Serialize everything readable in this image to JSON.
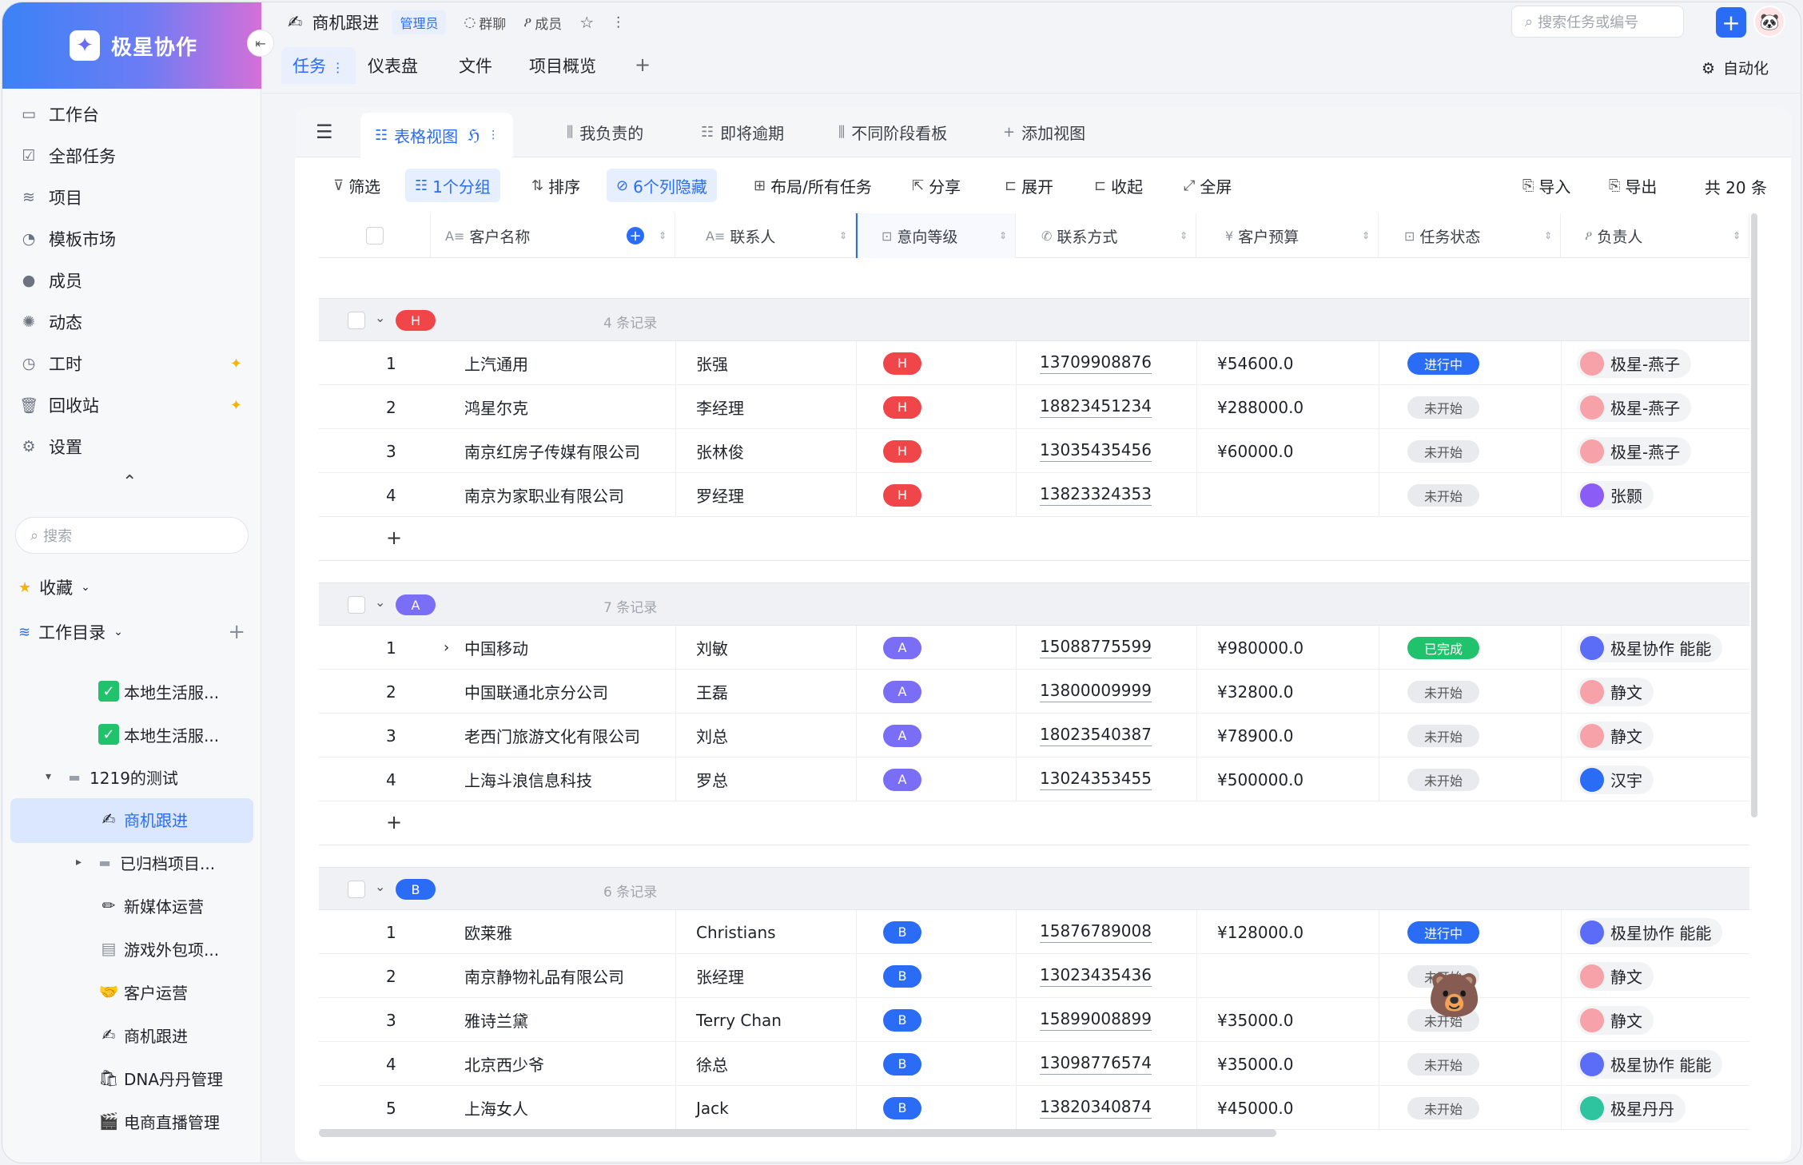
{
  "brand": {
    "name": "极星协作",
    "logo_icon": "sparkle-icon"
  },
  "sidebar": {
    "nav": [
      {
        "label": "工作台",
        "icon": "monitor-icon"
      },
      {
        "label": "全部任务",
        "icon": "task-icon"
      },
      {
        "label": "项目",
        "icon": "layers-icon"
      },
      {
        "label": "模板市场",
        "icon": "template-icon"
      },
      {
        "label": "成员",
        "icon": "user-icon"
      },
      {
        "label": "动态",
        "icon": "activity-icon"
      },
      {
        "label": "工时",
        "icon": "clock-icon",
        "starred": true
      },
      {
        "label": "回收站",
        "icon": "trash-icon",
        "starred": true
      },
      {
        "label": "设置",
        "icon": "gear-icon"
      }
    ],
    "search_placeholder": "搜索",
    "favorites_label": "收藏",
    "workdir_label": "工作目录",
    "tree": [
      {
        "label": "本地生活服...",
        "icon": "✅"
      },
      {
        "label": "本地生活服...",
        "icon": "✅"
      },
      {
        "label": "1219的测试",
        "icon": "folder"
      },
      {
        "label": "商机跟进",
        "icon": "✍"
      },
      {
        "label": "已归档项目...",
        "icon": "folder"
      },
      {
        "label": "新媒体运营",
        "icon": "✏"
      },
      {
        "label": "游戏外包项...",
        "icon": "doc"
      },
      {
        "label": "客户运营",
        "icon": "🤝"
      },
      {
        "label": "商机跟进",
        "icon": "✍"
      },
      {
        "label": "DNA丹丹管理",
        "icon": "🛍"
      },
      {
        "label": "电商直播管理",
        "icon": "🎬"
      }
    ]
  },
  "header": {
    "title": "商机跟进",
    "role_badge": "管理员",
    "group_chat": "群聊",
    "members": "成员",
    "search_placeholder": "搜索任务或编号",
    "plus": "+"
  },
  "tabs": {
    "items": [
      "任务",
      "仪表盘",
      "文件",
      "项目概览"
    ],
    "add": "+",
    "automation": "自动化"
  },
  "views": {
    "items": [
      "表格视图",
      "我负责的",
      "即将逾期",
      "不同阶段看板"
    ],
    "add": "添加视图"
  },
  "toolbar": {
    "filter": "筛选",
    "group": "1个分组",
    "sort": "排序",
    "hidden": "6个列隐藏",
    "layout": "布局/所有任务",
    "share": "分享",
    "expand": "展开",
    "collapse": "收起",
    "fullscreen": "全屏",
    "import": "导入",
    "export": "导出",
    "total": "共 20 条"
  },
  "columns": [
    "客户名称",
    "联系人",
    "意向等级",
    "联系方式",
    "客户预算",
    "任务状态",
    "负责人"
  ],
  "colors": {
    "H": "#f0464a",
    "A": "#7b6ef6",
    "B": "#2b6cf6",
    "accent": "#2b6cf6"
  },
  "groups": [
    {
      "key": "H",
      "count": "4 条记录",
      "rows": [
        {
          "n": "1",
          "name": "上汽通用",
          "contact": "张强",
          "phone": "13709908876",
          "budget": "¥54600.0",
          "status": "进行中",
          "owner": "极星-燕子"
        },
        {
          "n": "2",
          "name": "鸿星尔克",
          "contact": "李经理",
          "phone": "18823451234",
          "budget": "¥288000.0",
          "status": "未开始",
          "owner": "极星-燕子"
        },
        {
          "n": "3",
          "name": "南京红房子传媒有限公司",
          "contact": "张林俊",
          "phone": "13035435456",
          "budget": "¥60000.0",
          "status": "未开始",
          "owner": "极星-燕子"
        },
        {
          "n": "4",
          "name": "南京为家职业有限公司",
          "contact": "罗经理",
          "phone": "13823324353",
          "budget": "",
          "status": "未开始",
          "owner": "张颢"
        }
      ]
    },
    {
      "key": "A",
      "count": "7 条记录",
      "rows": [
        {
          "n": "1",
          "name": "中国移动",
          "contact": "刘敏",
          "phone": "15088775599",
          "budget": "¥980000.0",
          "status": "已完成",
          "owner": "极星协作 能能",
          "expand": true
        },
        {
          "n": "2",
          "name": "中国联通北京分公司",
          "contact": "王磊",
          "phone": "13800009999",
          "budget": "¥32800.0",
          "status": "未开始",
          "owner": "静文"
        },
        {
          "n": "3",
          "name": "老西门旅游文化有限公司",
          "contact": "刘总",
          "phone": "18023540387",
          "budget": "¥78900.0",
          "status": "未开始",
          "owner": "静文"
        },
        {
          "n": "4",
          "name": "上海斗浪信息科技",
          "contact": "罗总",
          "phone": "13024353455",
          "budget": "¥500000.0",
          "status": "未开始",
          "owner": "汉宇"
        }
      ]
    },
    {
      "key": "B",
      "count": "6 条记录",
      "rows": [
        {
          "n": "1",
          "name": "欧莱雅",
          "contact": "Christians",
          "phone": "15876789008",
          "budget": "¥128000.0",
          "status": "进行中",
          "owner": "极星协作 能能"
        },
        {
          "n": "2",
          "name": "南京静物礼品有限公司",
          "contact": "张经理",
          "phone": "13023435436",
          "budget": "",
          "status": "未开始",
          "owner": "静文"
        },
        {
          "n": "3",
          "name": "雅诗兰黛",
          "contact": "Terry Chan",
          "phone": "15899008899",
          "budget": "¥35000.0",
          "status": "未开始",
          "owner": "静文"
        },
        {
          "n": "4",
          "name": "北京西少爷",
          "contact": "徐总",
          "phone": "13098776574",
          "budget": "¥35000.0",
          "status": "未开始",
          "owner": "极星协作 能能"
        },
        {
          "n": "5",
          "name": "上海女人",
          "contact": "Jack",
          "phone": "13820340874",
          "budget": "¥45000.0",
          "status": "未开始",
          "owner": "极星丹丹"
        }
      ]
    }
  ]
}
